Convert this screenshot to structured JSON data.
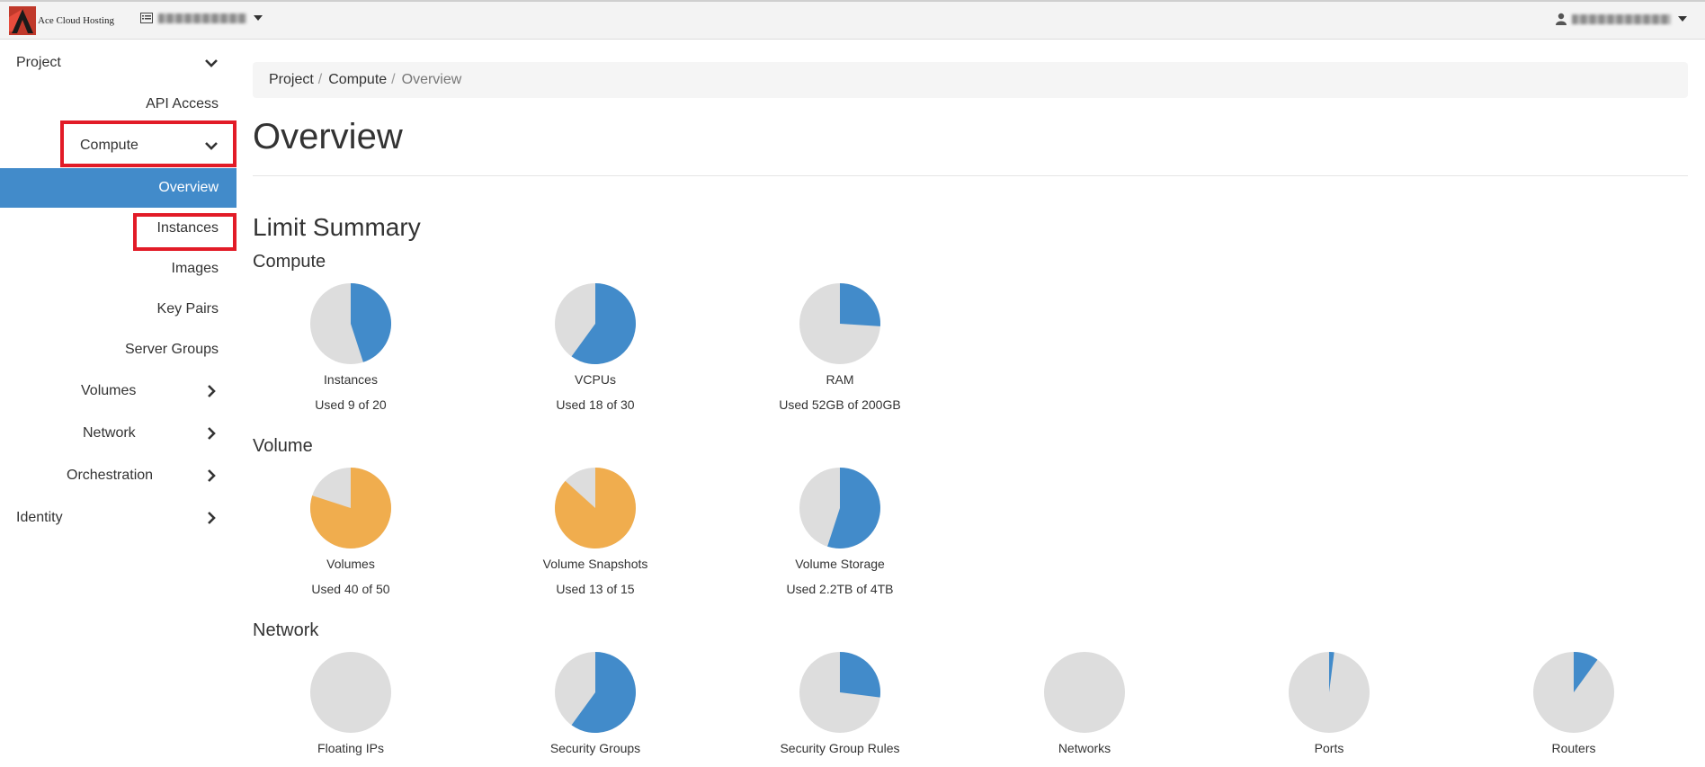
{
  "header": {
    "brand_name": "Ace Cloud Hosting",
    "icons": {
      "project": "project-list-icon",
      "user": "user-icon"
    }
  },
  "sidebar": {
    "items": [
      {
        "label": "Project",
        "chevron": "down"
      },
      {
        "label": "API Access"
      },
      {
        "label": "Compute",
        "chevron": "down",
        "highlighted": true
      },
      {
        "label": "Overview",
        "active": true
      },
      {
        "label": "Instances",
        "highlighted": true
      },
      {
        "label": "Images"
      },
      {
        "label": "Key Pairs"
      },
      {
        "label": "Server Groups"
      },
      {
        "label": "Volumes",
        "chevron": "right"
      },
      {
        "label": "Network",
        "chevron": "right"
      },
      {
        "label": "Orchestration",
        "chevron": "right"
      },
      {
        "label": "Identity",
        "chevron": "right"
      }
    ]
  },
  "breadcrumb": {
    "items": [
      "Project",
      "Compute"
    ],
    "separator": "/",
    "current": "Overview"
  },
  "page": {
    "title": "Overview",
    "limit_summary": "Limit Summary"
  },
  "sections": [
    {
      "title": "Compute",
      "charts": [
        {
          "name": "Instances",
          "used_text": "Used 9 of 20",
          "fraction": 0.45,
          "color": "#428bca"
        },
        {
          "name": "VCPUs",
          "used_text": "Used 18 of 30",
          "fraction": 0.6,
          "color": "#428bca"
        },
        {
          "name": "RAM",
          "used_text": "Used 52GB of 200GB",
          "fraction": 0.26,
          "color": "#428bca"
        }
      ]
    },
    {
      "title": "Volume",
      "charts": [
        {
          "name": "Volumes",
          "used_text": "Used 40 of 50",
          "fraction": 0.8,
          "color": "#f0ad4e"
        },
        {
          "name": "Volume Snapshots",
          "used_text": "Used 13 of 15",
          "fraction": 0.867,
          "color": "#f0ad4e"
        },
        {
          "name": "Volume Storage",
          "used_text": "Used 2.2TB of 4TB",
          "fraction": 0.55,
          "color": "#428bca"
        }
      ]
    },
    {
      "title": "Network",
      "charts": [
        {
          "name": "Floating IPs",
          "used_text": "",
          "fraction": 0,
          "color": "#428bca"
        },
        {
          "name": "Security Groups",
          "used_text": "",
          "fraction": 0.6,
          "color": "#428bca"
        },
        {
          "name": "Security Group Rules",
          "used_text": "",
          "fraction": 0.27,
          "color": "#428bca"
        },
        {
          "name": "Networks",
          "used_text": "",
          "fraction": 0,
          "color": "#428bca"
        },
        {
          "name": "Ports",
          "used_text": "",
          "fraction": 0.02,
          "color": "#428bca"
        },
        {
          "name": "Routers",
          "used_text": "",
          "fraction": 0.1,
          "color": "#428bca"
        }
      ]
    }
  ],
  "colors": {
    "accent": "#428bca",
    "warning": "#f0ad4e",
    "unused": "#dddddd",
    "highlight_box": "#e21b27"
  }
}
